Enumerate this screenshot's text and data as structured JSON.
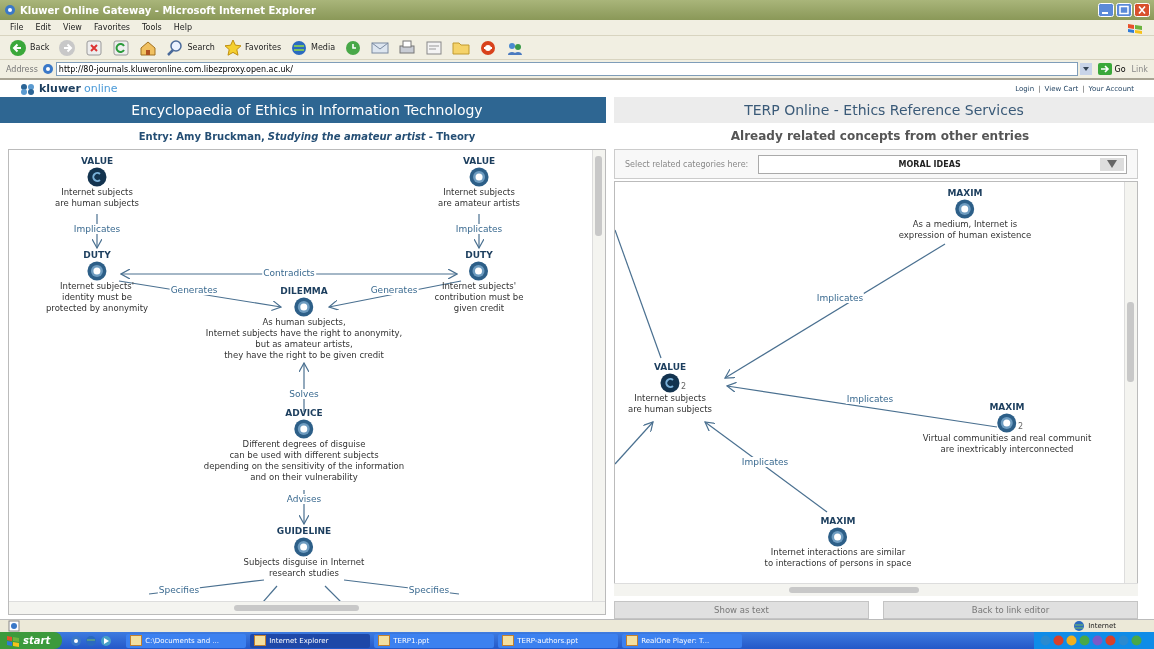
{
  "window": {
    "title": "Kluwer Online Gateway - Microsoft Internet Explorer"
  },
  "menu_bar": [
    "File",
    "Edit",
    "View",
    "Favorites",
    "Tools",
    "Help"
  ],
  "toolbar": [
    {
      "kind": "back",
      "label": "Back"
    },
    {
      "kind": "forward"
    },
    {
      "kind": "stop"
    },
    {
      "kind": "refresh"
    },
    {
      "kind": "home"
    },
    {
      "kind": "search",
      "label": "Search"
    },
    {
      "kind": "favorites",
      "label": "Favorites"
    },
    {
      "kind": "media",
      "label": "Media"
    },
    {
      "kind": "history"
    },
    {
      "kind": "mail"
    },
    {
      "kind": "print"
    },
    {
      "kind": "edit"
    },
    {
      "kind": "folder"
    },
    {
      "kind": "browser"
    },
    {
      "kind": "messenger"
    }
  ],
  "address_bar": {
    "label": "Address",
    "value": "http://80-journals.kluweronline.com.libezproxy.open.ac.uk/",
    "go": "Go",
    "links": "Link"
  },
  "site_header": {
    "logo_brand": "kluwer",
    "logo_suffix": "online",
    "separator": "|",
    "links": [
      "Login",
      "View Cart",
      "Your Account"
    ]
  },
  "left_panel": {
    "title": "Encyclopaedia of Ethics in Information Technology",
    "entry": "Entry: Amy Bruckman, *Studying the amateur artist* - Theory",
    "diagram": {
      "nodes": [
        {
          "category": "VALUE",
          "text": "Internet subjects\nare human subjects",
          "focus": true
        },
        {
          "category": "VALUE",
          "text": "Internet subjects\nare amateur artists",
          "focus": false
        },
        {
          "category": "DUTY",
          "text": "Internet subjects'\nidentity must be\nprotected by anonymity",
          "focus": false
        },
        {
          "category": "DUTY",
          "text": "Internet subjects'\ncontribution must be\ngiven credit",
          "focus": false
        },
        {
          "category": "DILEMMA",
          "text": "As human subjects,\nInternet subjects have the right to anonymity,\nbut as amateur artists,\nthey have the right to be given credit",
          "focus": false
        },
        {
          "category": "ADVICE",
          "text": "Different degrees of disguise\ncan be used with different subjects\ndepending on the sensitivity of the information\nand on their vulnerability",
          "focus": false
        },
        {
          "category": "GUIDELINE",
          "text": "Subjects disguise in Internet\nresearch studies",
          "focus": false
        }
      ],
      "edges": [
        {
          "label": "Implicates",
          "kind": "arrow"
        },
        {
          "label": "Implicates",
          "kind": "arrow"
        },
        {
          "label": "Contradicts",
          "kind": "double"
        },
        {
          "label": "Generates",
          "kind": "arrow"
        },
        {
          "label": "Generates",
          "kind": "arrow"
        },
        {
          "label": "Solves",
          "kind": "arrow"
        },
        {
          "label": "Advises",
          "kind": "arrow"
        },
        {
          "label": "Specifies",
          "kind": "line"
        },
        {
          "label": "Specifies",
          "kind": "line"
        },
        {
          "kind": "line"
        },
        {
          "kind": "line"
        }
      ]
    }
  },
  "right_panel": {
    "title": "TERP Online - Ethics Reference Services",
    "subtitle": "Already related concepts from other entries",
    "category_label": "Select related categories here:",
    "category_value": "MORAL IDEAS",
    "diagram": {
      "nodes": [
        {
          "category": "MAXIM",
          "text": "As a medium, Internet is\nexpression of human existence",
          "focus": false
        },
        {
          "category": "VALUE",
          "text": "Internet subjects\nare human subjects",
          "focus": true,
          "count": "2"
        },
        {
          "category": "MAXIM",
          "text": "Virtual communities and real communit\nare inextricably interconnected",
          "focus": false,
          "count": "2"
        },
        {
          "category": "MAXIM",
          "text": "Internet interactions are similar\nto interactions of persons in space",
          "focus": false
        }
      ],
      "edges": [
        {
          "label": "Implicates",
          "kind": "arrow"
        },
        {
          "label": "Implicates",
          "kind": "arrow"
        },
        {
          "label": "Implicates",
          "kind": "arrow"
        },
        {
          "kind": "line"
        },
        {
          "kind": "arrow"
        }
      ]
    },
    "buttons": [
      "Show as text",
      "Back to link editor"
    ]
  },
  "status_bar": {
    "zone": "Internet"
  },
  "taskbar": {
    "start": "start",
    "tasks": [
      {
        "label": "C:\\Documents and ...",
        "selected": false
      },
      {
        "label": "Internet Explorer",
        "selected": true
      },
      {
        "label": "TERP1.ppt",
        "selected": false
      },
      {
        "label": "TERP-authors.ppt",
        "selected": false
      },
      {
        "label": "RealOne Player: T...",
        "selected": false
      }
    ]
  }
}
